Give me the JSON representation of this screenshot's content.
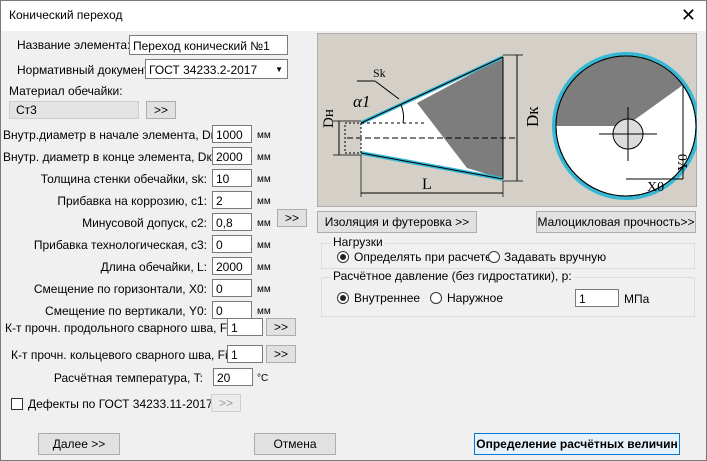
{
  "window": {
    "title": "Конический переход",
    "close_glyph": "✕"
  },
  "element_name": {
    "label": "Название элемента:",
    "value": "Переход конический №1"
  },
  "normative_doc": {
    "label": "Нормативный документ:",
    "value": "ГОСТ 34233.2-2017"
  },
  "material": {
    "label": "Материал обечайки:",
    "value": "Ст3",
    "button": ">>"
  },
  "fields": [
    {
      "label": "Внутр.диаметр в начале элемента, Dн:",
      "value": "1000",
      "unit": "мм"
    },
    {
      "label": "Внутр. диаметр в конце элемента, Dк:",
      "value": "2000",
      "unit": "мм"
    },
    {
      "label": "Толщина стенки обечайки, sk:",
      "value": "10",
      "unit": "мм"
    },
    {
      "label": "Прибавка на коррозию, c1:",
      "value": "2",
      "unit": "мм"
    },
    {
      "label": "Минусовой допуск, c2:",
      "value": "0,8",
      "unit": "мм"
    },
    {
      "label": "Прибавка технологическая, c3:",
      "value": "0",
      "unit": "мм"
    },
    {
      "label": "Длина обечайки, L:",
      "value": "2000",
      "unit": "мм"
    },
    {
      "label": "Смещение по горизонтали, X0:",
      "value": "0",
      "unit": "мм"
    },
    {
      "label": "Смещение по вертикали, Y0:",
      "value": "0",
      "unit": "мм"
    }
  ],
  "c2_button": ">>",
  "weld_long": {
    "label": "К-т прочн. продольного сварного шва, Fip:",
    "value": "1",
    "button": ">>"
  },
  "weld_circ": {
    "label": "К-т прочн. кольцевого сварного шва, Fit:",
    "value": "1",
    "button": ">>"
  },
  "temperature": {
    "label": "Расчётная температура, T:",
    "value": "20",
    "unit": "°C"
  },
  "defects": {
    "label": "Дефекты по ГОСТ 34233.11-2017",
    "button": ">>",
    "checked": false
  },
  "diagram": {
    "dh": "Dн",
    "dk": "Dк",
    "sk": "Sk",
    "alpha": "α1",
    "l": "L",
    "x0": "X0",
    "y0": "Y0",
    "colors": {
      "background": "#d4d0c8",
      "wall": "#36b7d4",
      "shade": "#7d7d7d"
    }
  },
  "insulation_button": "Изоляция и футеровка >>",
  "lowcycle_button": "Малоцикловая прочность>>",
  "loads": {
    "title": "Нагрузки",
    "options": [
      "Определять при расчете",
      "Задавать вручную"
    ],
    "selected": 0
  },
  "pressure": {
    "title": "Расчётное давление (без гидростатики), p:",
    "options": [
      "Внутреннее",
      "Наружное"
    ],
    "selected": 0,
    "value": "1",
    "unit": "МПа"
  },
  "footer": {
    "next": "Далее >>",
    "cancel": "Отмена",
    "determine": "Определение расчётных величин"
  }
}
